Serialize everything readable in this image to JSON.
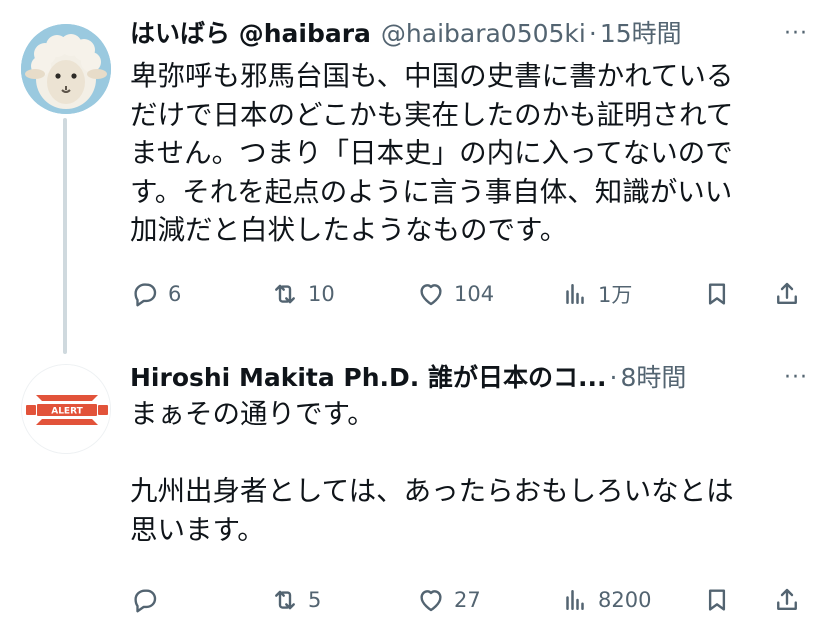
{
  "tweets": [
    {
      "display_name": "はいばら @haibara",
      "handle": "@haibara0505ki",
      "separator": "·",
      "time": "15時間",
      "more": "···",
      "text": "卑弥呼も邪馬台国も、中国の史書に書かれている\nだけで日本のどこかも実在したのかも証明されて\nません。つまり「日本史」の内に入ってないので\nす。それを起点のように言う事自体、知識がいい\n加減だと白状したようなものです。",
      "replies": "6",
      "retweets": "10",
      "likes": "104",
      "views": "1万"
    },
    {
      "display_name": "Hiroshi Makita Ph.D. 誰が日本のコ...",
      "separator": "·",
      "time": "8時間",
      "more": "···",
      "avatar_text": "ALERT",
      "text": "まぁその通りです。\n\n九州出身者としては、あったらおもしろいなとは\n思います。",
      "replies": "",
      "retweets": "5",
      "likes": "27",
      "views": "8200"
    }
  ],
  "colors": {
    "text": "#0f1419",
    "secondary": "#536471",
    "thread_line": "#cfd9de",
    "alert_red": "#e2533a",
    "sheep_bg": "#9ac9df"
  }
}
